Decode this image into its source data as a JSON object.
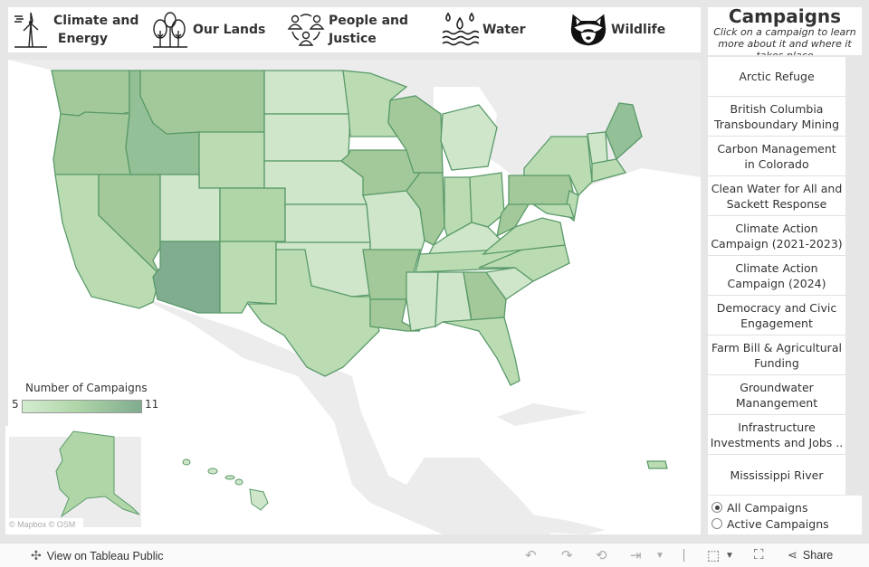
{
  "categories": [
    {
      "icon": "wind-turbine-icon",
      "line1": "Climate and",
      "line2": "Energy"
    },
    {
      "icon": "trees-icon",
      "line1": "Our Lands",
      "line2": ""
    },
    {
      "icon": "people-network-icon",
      "line1": "People and",
      "line2": "Justice"
    },
    {
      "icon": "water-drops-icon",
      "line1": "Water",
      "line2": ""
    },
    {
      "icon": "raccoon-icon",
      "line1": "Wildlife",
      "line2": ""
    }
  ],
  "campaigns_panel": {
    "title": "Campaigns",
    "subtitle": "Click on a campaign to learn more about it and where it takes place",
    "items": [
      {
        "line1": "Arctic Refuge",
        "line2": ""
      },
      {
        "line1": "British Columbia",
        "line2": "Transboundary Mining"
      },
      {
        "line1": "Carbon Management",
        "line2": "in Colorado"
      },
      {
        "line1": "Clean Water for All and",
        "line2": "Sackett Response"
      },
      {
        "line1": "Climate Action",
        "line2": "Campaign (2021-2023)"
      },
      {
        "line1": "Climate Action",
        "line2": "Campaign (2024)"
      },
      {
        "line1": "Democracy and Civic",
        "line2": "Engagement"
      },
      {
        "line1": "Farm Bill & Agricultural",
        "line2": "Funding"
      },
      {
        "line1": "Groundwater",
        "line2": "Manangement"
      },
      {
        "line1": "Infrastructure",
        "line2": "Investments and Jobs .."
      },
      {
        "line1": "Mississippi River",
        "line2": ""
      }
    ]
  },
  "filter": {
    "options": [
      {
        "label": "All Campaigns",
        "selected": true
      },
      {
        "label": "Active Campaigns",
        "selected": false
      }
    ]
  },
  "map": {
    "legend_title": "Number of Campaigns",
    "legend_min": "5",
    "legend_max": "11",
    "color_low": "#d4ecd0",
    "color_high": "#80ac8f",
    "border_color": "#5a9a6a",
    "attribution": "© Mapbox © OSM"
  },
  "toolbar": {
    "view_label": "View on Tableau Public",
    "share_label": "Share"
  }
}
